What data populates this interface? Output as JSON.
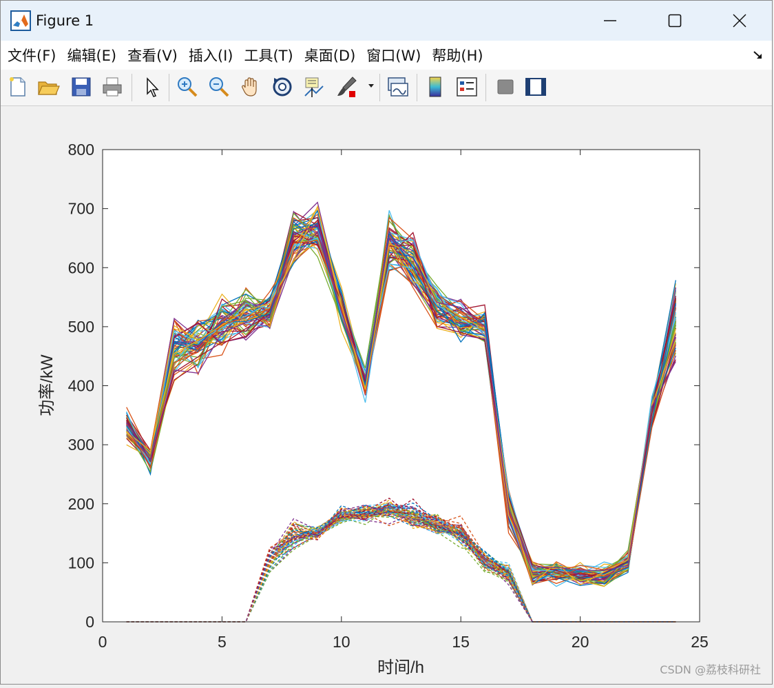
{
  "window": {
    "title": "Figure 1",
    "icons": [
      "matlab-icon",
      "minimize-icon",
      "maximize-icon",
      "close-icon"
    ]
  },
  "menu": {
    "items": [
      "文件(F)",
      "编辑(E)",
      "查看(V)",
      "插入(I)",
      "工具(T)",
      "桌面(D)",
      "窗口(W)",
      "帮助(H)"
    ],
    "dock_icon": "dock-arrow-icon"
  },
  "toolbar": {
    "icons": [
      "new-figure-icon",
      "open-file-icon",
      "save-icon",
      "print-icon",
      "edit-plot-arrow-icon",
      "zoom-in-icon",
      "zoom-out-icon",
      "pan-hand-icon",
      "rotate-3d-icon",
      "data-cursor-icon",
      "brush-icon",
      "link-plot-icon",
      "colorbar-icon",
      "legend-icon",
      "hide-plot-tools-icon",
      "show-plot-tools-icon"
    ]
  },
  "watermark": "CSDN @荔枝科研社",
  "colors": {
    "series_palette": [
      "#0072BD",
      "#D95319",
      "#EDB120",
      "#7E2F8E",
      "#77AC30",
      "#4DBEEE",
      "#A2142F"
    ],
    "axes": "#262626",
    "background": "#f0f0f0"
  },
  "chart_data": {
    "type": "line",
    "xlabel": "时间/h",
    "ylabel": "功率/kW",
    "xlim": [
      0,
      25
    ],
    "ylim": [
      0,
      800
    ],
    "xticks": [
      0,
      5,
      10,
      15,
      20,
      25
    ],
    "yticks": [
      0,
      100,
      200,
      300,
      400,
      500,
      600,
      700,
      800
    ],
    "grid": false,
    "x": [
      1,
      2,
      3,
      4,
      5,
      6,
      7,
      8,
      9,
      10,
      11,
      12,
      13,
      14,
      15,
      16,
      17,
      18,
      19,
      20,
      21,
      22,
      23,
      24
    ],
    "groups": [
      {
        "style": "solid",
        "count": 60,
        "mean": [
          335,
          275,
          465,
          470,
          500,
          520,
          525,
          650,
          665,
          530,
          400,
          640,
          610,
          530,
          510,
          500,
          190,
          80,
          85,
          80,
          80,
          100,
          350,
          520
        ],
        "spread": [
          14,
          12,
          22,
          25,
          22,
          20,
          15,
          25,
          20,
          15,
          12,
          25,
          25,
          18,
          18,
          15,
          15,
          10,
          10,
          8,
          10,
          10,
          12,
          30
        ]
      },
      {
        "style": "dashed",
        "count": 60,
        "mean": [
          0,
          0,
          0,
          0,
          0,
          0,
          105,
          145,
          150,
          180,
          185,
          190,
          180,
          165,
          150,
          105,
          80,
          0,
          0,
          0,
          0,
          0,
          0,
          0
        ],
        "spread": [
          0,
          0,
          0,
          0,
          0,
          0,
          10,
          12,
          5,
          6,
          8,
          10,
          10,
          8,
          10,
          8,
          8,
          0,
          0,
          0,
          0,
          0,
          0,
          0
        ]
      }
    ]
  }
}
